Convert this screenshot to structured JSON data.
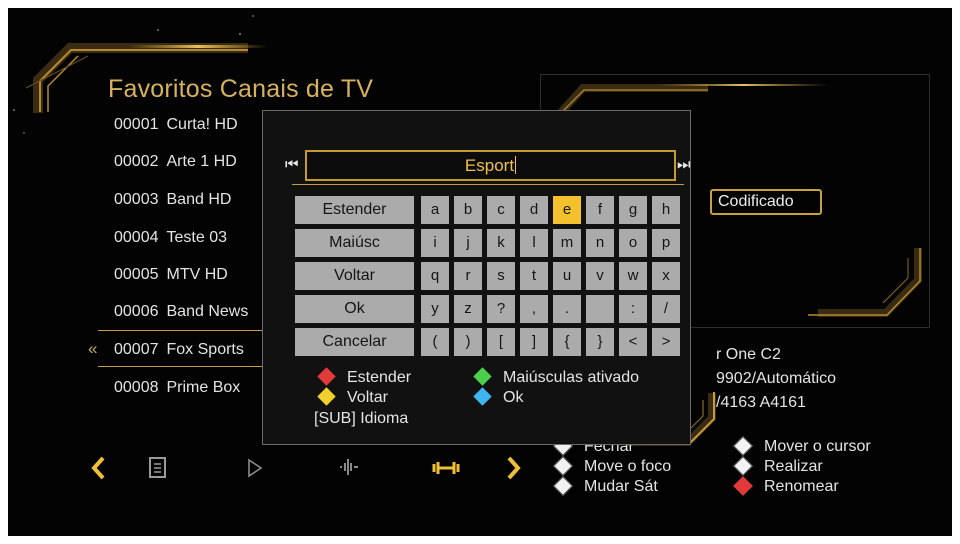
{
  "screen": {
    "title": "Favoritos Canais de TV",
    "channels": [
      {
        "num": "00001",
        "name": "Curta! HD"
      },
      {
        "num": "00002",
        "name": "Arte 1 HD"
      },
      {
        "num": "00003",
        "name": "Band HD"
      },
      {
        "num": "00004",
        "name": "Teste 03"
      },
      {
        "num": "00005",
        "name": "MTV HD"
      },
      {
        "num": "00006",
        "name": "Band News"
      },
      {
        "num": "00007",
        "name": "Fox Sports"
      },
      {
        "num": "00008",
        "name": "Prime Box"
      }
    ],
    "selected_marker": "«",
    "info": {
      "codificado": "Codificado",
      "satellite": "r One C2",
      "transponder": "9902/Automático",
      "pids": "/4163  A4161"
    },
    "help": {
      "fechar": "Fechar",
      "mover_foco": "Move o foco",
      "mudar_sat": "Mudar Sát",
      "mover_cursor": "Mover o cursor",
      "realizar": "Realizar",
      "renomear": "Renomear"
    }
  },
  "dialog": {
    "input_value": "Esport",
    "prev_icon": "⏮",
    "next_icon": "⏭",
    "function_buttons": [
      "Estender",
      "Maiúsc",
      "Voltar",
      "Ok",
      "Cancelar"
    ],
    "keys": [
      [
        "a",
        "b",
        "c",
        "d",
        "e",
        "f",
        "g",
        "h"
      ],
      [
        "i",
        "j",
        "k",
        "l",
        "m",
        "n",
        "o",
        "p"
      ],
      [
        "q",
        "r",
        "s",
        "t",
        "u",
        "v",
        "w",
        "x"
      ],
      [
        "y",
        "z",
        "?",
        ",",
        ".",
        "",
        ":",
        "/"
      ],
      [
        "(",
        ")",
        "[",
        "]",
        "{",
        "}",
        "<",
        ">"
      ]
    ],
    "selected_key": "e",
    "legend": {
      "red": "Estender",
      "green": "Maiúsculas ativado",
      "yellow": "Voltar",
      "blue": "Ok",
      "sub": "[SUB]  Idioma"
    }
  },
  "colors": {
    "accent_gold": "#d8b25a",
    "selected_key": "#f3c12e",
    "key_bg": "#ababab",
    "red": "#e23a3a",
    "green": "#4cd04c",
    "yellow": "#f0d12c",
    "blue": "#3fb4ee"
  },
  "icons": [
    "chevron-left-icon",
    "document-icon",
    "play-icon",
    "waveform-icon",
    "dumbbell-icon",
    "chevron-right-icon"
  ]
}
